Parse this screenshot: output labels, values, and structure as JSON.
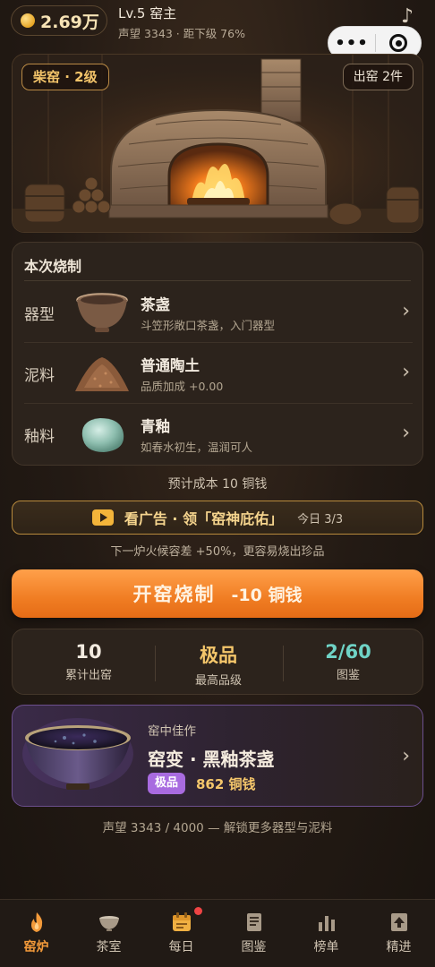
{
  "top": {
    "coins": "2.69万",
    "level_title": "Lv.5 窑主",
    "level_sub": "声望 3343 · 距下级 76%",
    "next_level_progress": 0.76
  },
  "scene": {
    "kiln_badge": "柴窑 · 2级",
    "out_badge": "出窑 2件"
  },
  "firing": {
    "title": "本次烧制",
    "rows": [
      {
        "label": "器型",
        "name": "茶盏",
        "desc": "斗笠形敞口茶盏，入门器型",
        "icon": "tea-bowl-icon"
      },
      {
        "label": "泥料",
        "name": "普通陶土",
        "desc": "品质加成 +0.00",
        "icon": "clay-pile-icon"
      },
      {
        "label": "釉料",
        "name": "青釉",
        "desc": "如春水初生，温润可人",
        "icon": "glaze-stone-icon"
      }
    ],
    "cost_line": "预计成本 10 铜钱"
  },
  "ad": {
    "label": "看广告 · 领「窑神庇佑」",
    "count": "今日 3/3",
    "note": "下一炉火候容差 +50%，更容易烧出珍品"
  },
  "main_button": {
    "label": "开窑烧制",
    "cost": "-10 铜钱"
  },
  "stats": [
    {
      "value": "10",
      "label": "累计出窑"
    },
    {
      "value": "极品",
      "label": "最高品级"
    },
    {
      "value": "2/60",
      "label": "图鉴"
    }
  ],
  "featured": {
    "kicker": "窑中佳作",
    "name": "窑变 · 黑釉茶盏",
    "badge": "极品",
    "price": "862 铜钱"
  },
  "prestige_line": "声望 3343 / 4000 — 解锁更多器型与泥料",
  "nav": [
    {
      "label": "窑炉",
      "icon": "flame-icon",
      "active": true
    },
    {
      "label": "茶室",
      "icon": "bowl-icon"
    },
    {
      "label": "每日",
      "icon": "calendar-icon",
      "badge": true
    },
    {
      "label": "图鉴",
      "icon": "book-icon"
    },
    {
      "label": "榜单",
      "icon": "bar-chart-icon"
    },
    {
      "label": "精进",
      "icon": "upgrade-icon"
    }
  ],
  "colors": {
    "accent_orange": "#f07d23",
    "gold": "#f5c76b",
    "teal": "#6fd3c6",
    "purple_badge": "#a86be0",
    "background": "#1f1813"
  }
}
